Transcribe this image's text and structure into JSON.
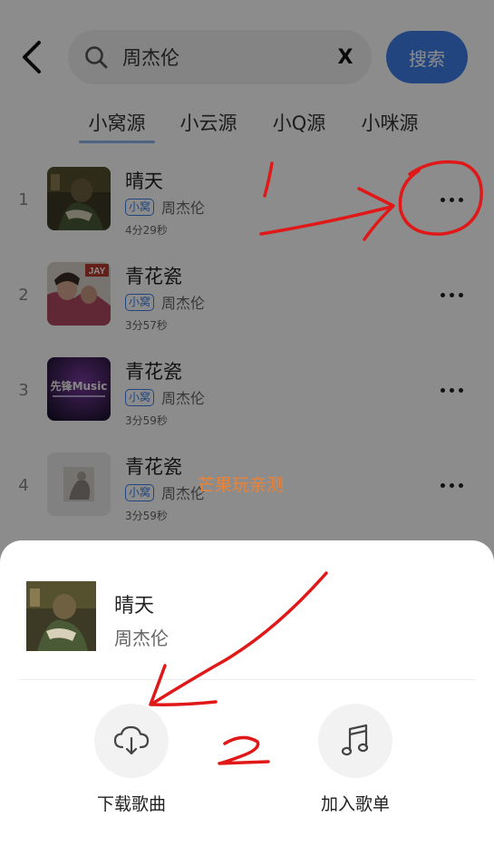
{
  "search": {
    "query": "周杰伦",
    "clear_label": "X",
    "button_label": "搜索"
  },
  "tabs": [
    {
      "label": "小窝源",
      "active": true
    },
    {
      "label": "小云源",
      "active": false
    },
    {
      "label": "小Q源",
      "active": false
    },
    {
      "label": "小咪源",
      "active": false
    }
  ],
  "songs": [
    {
      "index": "1",
      "title": "晴天",
      "source": "小窝",
      "artist": "周杰伦",
      "duration": "4分29秒"
    },
    {
      "index": "2",
      "title": "青花瓷",
      "source": "小窝",
      "artist": "周杰伦",
      "duration": "3分57秒"
    },
    {
      "index": "3",
      "title": "青花瓷",
      "source": "小窝",
      "artist": "周杰伦",
      "duration": "3分59秒"
    },
    {
      "index": "4",
      "title": "青花瓷",
      "source": "小窝",
      "artist": "周杰伦",
      "duration": "3分59秒"
    }
  ],
  "covers": {
    "song2_badge": "JAY",
    "song3_text": "先锋Music"
  },
  "watermark": "芒果玩亲测",
  "sheet": {
    "title": "晴天",
    "artist": "周杰伦",
    "actions": [
      {
        "label": "下载歌曲",
        "icon": "cloud-download-icon"
      },
      {
        "label": "加入歌单",
        "icon": "music-note-icon"
      }
    ]
  },
  "annotations": {
    "step1": "1",
    "step2": "2"
  },
  "colors": {
    "accent": "#3f7fe8",
    "annotation": "#e01818",
    "watermark": "#e8833a"
  }
}
